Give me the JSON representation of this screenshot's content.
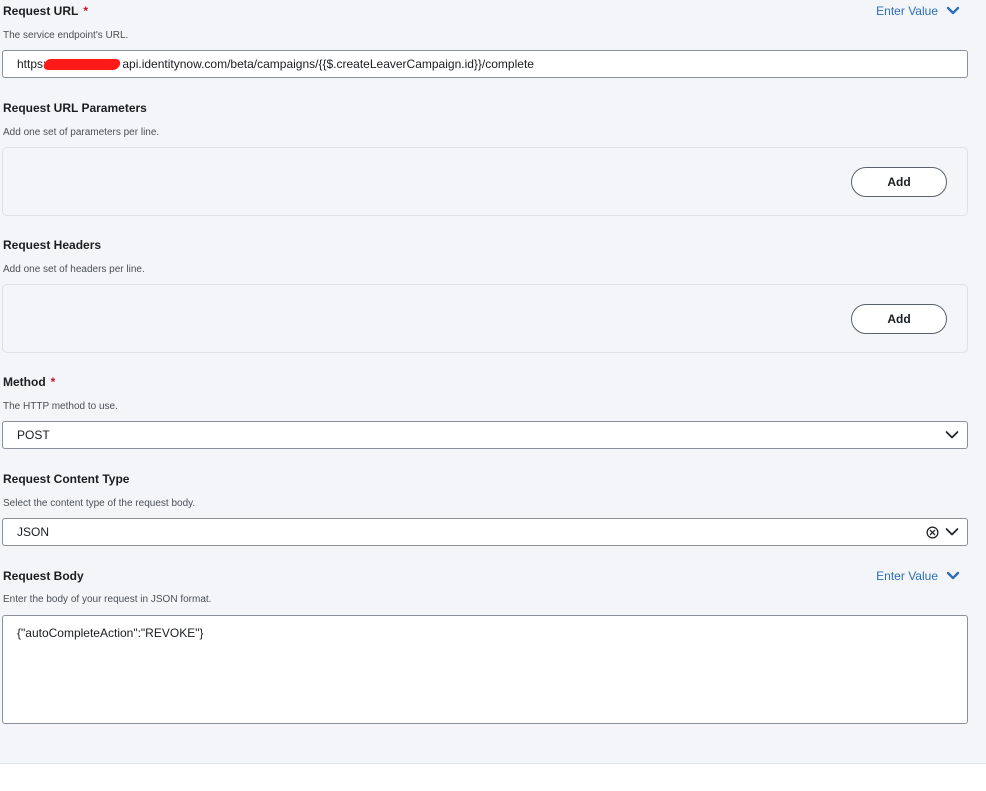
{
  "request_url": {
    "label": "Request URL",
    "required_mark": "*",
    "enter_value": "Enter Value",
    "help": "The service endpoint's URL.",
    "value_prefix": "https:",
    "value_suffix": "api.identitynow.com/beta/campaigns/{{$.createLeaverCampaign.id}}/complete"
  },
  "url_params": {
    "label": "Request URL Parameters",
    "help": "Add one set of parameters per line.",
    "add_label": "Add"
  },
  "headers": {
    "label": "Request Headers",
    "help": "Add one set of headers per line.",
    "add_label": "Add"
  },
  "method": {
    "label": "Method",
    "required_mark": "*",
    "help": "The HTTP method to use.",
    "value": "POST"
  },
  "content_type": {
    "label": "Request Content Type",
    "help": "Select the content type of the request body.",
    "value": "JSON"
  },
  "request_body": {
    "label": "Request Body",
    "enter_value": "Enter Value",
    "help": "Enter the body of your request in JSON format.",
    "value": "{\"autoCompleteAction\":\"REVOKE\"}"
  },
  "colors": {
    "panel_bg": "#f3f5f8",
    "link": "#2d6fb7",
    "required": "#c8102e",
    "border": "#8a9099"
  }
}
